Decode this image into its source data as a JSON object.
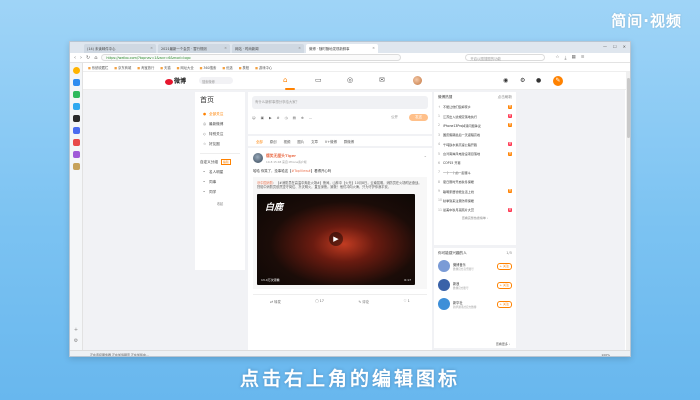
{
  "brand": "简间·视频",
  "subtitle": "点击右上角的编辑图标",
  "browser": {
    "tabs": [
      {
        "label": "(14) 未读邮件中心"
      },
      {
        "label": "2021最新一个会员 · 暂行规则"
      },
      {
        "label": "网站 · 时尚新闻"
      },
      {
        "label": "微博 · 随时随地发现新鲜事"
      }
    ],
    "url": "https://weibo.com/?topnav=1&wvr=6&mod=logo",
    "search_placeholder": "开启以图搜图的功能",
    "bookmarks": [
      "系统收藏栏",
      "京东商城",
      "淘宝旅行",
      "天猫",
      "网址大全",
      "360搜索",
      "优选",
      "携程",
      "游戏中心"
    ],
    "window_buttons": [
      "—",
      "☐",
      "✕"
    ]
  },
  "weibo": {
    "logo": "微博",
    "search_placeholder": "搜索微博",
    "nav": {
      "title": "首页",
      "items": [
        {
          "icon": "●",
          "label": "全部关注",
          "active": true
        },
        {
          "icon": "◎",
          "label": "最新微博",
          "active": false
        },
        {
          "icon": "◇",
          "label": "特别关注",
          "active": false
        },
        {
          "icon": "☆",
          "label": "好友圈",
          "active": false
        }
      ],
      "group_title": "自定义分组",
      "group_badge": "编辑",
      "groups": [
        "名人明星",
        "同事",
        "同学"
      ],
      "collapse": "收起"
    },
    "composer": {
      "placeholder": "有什么新鲜事想分享给大家？",
      "tools": [
        "☺",
        "▣",
        "▶",
        "#",
        "◷",
        "▤",
        "⊕",
        "…"
      ],
      "visibility": "公开",
      "send": "发送"
    },
    "feed_tabs": [
      "全部",
      "原创",
      "视频",
      "图片",
      "文章",
      "V+微博",
      "群微博"
    ],
    "post": {
      "author": "爆笑无厘头Tiger",
      "meta": "10-8 15:48 来自 iPhone客户端",
      "text_prefix": "哈哈 你笑了，没事哈这【",
      "text_tag": "#TopView#",
      "text_suffix": "】看得开心吗",
      "repost_author": "@中国消防",
      "repost_text": "【#消防员在高温中奔赴火场#】夜间，山林中【火光】10月8日，云南昆明，消防员在火场附近奋战。烈焰中消防员依然坚守岗位、扑灭明火，直至深夜。致敬！他们冲向火海，只为守护你我平安。",
      "video_logo": "白鹿",
      "views": "13.4万次观看",
      "duration": "0:17",
      "actions": [
        "转发",
        "17",
        "评论",
        "1"
      ]
    },
    "hot": {
      "title": "微博热搜",
      "refresh": "点击刷新",
      "items": [
        {
          "rank": "",
          "text": "不能让他们毁掉家乡",
          "badge": "热",
          "color": "#ff8200"
        },
        {
          "rank": "1",
          "text": "江苏出入境规定落地执行",
          "badge": "新",
          "color": "#ff3852"
        },
        {
          "rank": "2",
          "text": "iPhone13Pro掉漆问题争议",
          "badge": "热",
          "color": "#ff8200"
        },
        {
          "rank": "3",
          "text": "国庆假期最后一天返程高峰",
          "badge": "",
          "color": ""
        },
        {
          "rank": "4",
          "text": "千吨铁水乘高速公路开跑",
          "badge": "新",
          "color": "#ff3852"
        },
        {
          "rank": "5",
          "text": "台湾离岸风电建设项目落地",
          "badge": "热",
          "color": "#ff8200"
        },
        {
          "rank": "6",
          "text": "COP15 开幕",
          "badge": "",
          "color": ""
        },
        {
          "rank": "7",
          "text": "一个一个的一起奋斗",
          "badge": "",
          "color": ""
        },
        {
          "rank": "8",
          "text": "夏日限时开启秋冬保暖",
          "badge": "",
          "color": ""
        },
        {
          "rank": "9",
          "text": "聪明家居智能生活上线",
          "badge": "热",
          "color": "#ff8200"
        },
        {
          "rank": "10",
          "text": "秋季到来注意防寒保暖",
          "badge": "",
          "color": ""
        },
        {
          "rank": "11",
          "text": "最美中秋月亮照片大赏",
          "badge": "新",
          "color": "#ff3852"
        }
      ],
      "more": "查看完整热搜榜单 ›"
    },
    "recommend": {
      "title": "你可能感兴趣的人",
      "pager": "1/5",
      "users": [
        {
          "name": "微博音乐",
          "desc": "微博官方音乐账号",
          "follow": "+ 关注",
          "color": "#7a9bd6"
        },
        {
          "name": "新浪",
          "desc": "微博官方账号",
          "follow": "+ 关注",
          "color": "#3a62a8"
        },
        {
          "name": "新华社",
          "desc": "新华通讯社官方微博",
          "follow": "+ 关注",
          "color": "#3e8fd8"
        }
      ],
      "tofollow": "查看更多 ›"
    }
  },
  "status_left": "正在连接服务器 正在加载网页 正在加载中…",
  "status_right": "100%"
}
